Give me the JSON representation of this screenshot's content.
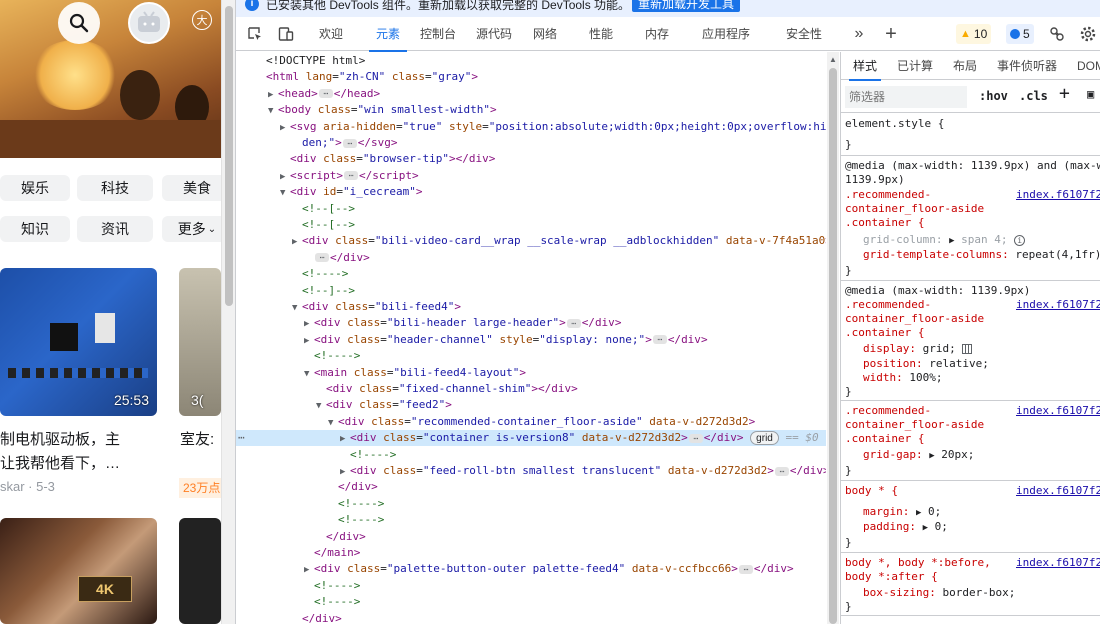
{
  "page": {
    "categories": [
      "娱乐",
      "科技",
      "美食",
      "知识",
      "资讯",
      "更多"
    ],
    "video1": {
      "duration": "25:53",
      "title_line1": "制电机驱动板，主",
      "title_line2": "让我帮他看下，…",
      "meta": "skar · 5-3"
    },
    "video2": {
      "duration": "3(",
      "title": "室友:",
      "hot": "23万点"
    },
    "video3": {
      "logo": "4K"
    }
  },
  "devtools": {
    "infobar": {
      "message": "已安装其他 DevTools 组件。重新加载以获取完整的 DevTools 功能。",
      "button": "重新加载开发工具"
    },
    "tabs": [
      "欢迎",
      "元素",
      "控制台",
      "源代码",
      "网络",
      "性能",
      "内存",
      "应用程序",
      "安全性"
    ],
    "active_tab": "元素",
    "warnings": "10",
    "messages": "5",
    "tree": [
      {
        "indent": 0,
        "tri": "",
        "html": "doctype"
      },
      {
        "indent": 0,
        "tri": "",
        "html": "html"
      },
      {
        "indent": 1,
        "tri": "▶",
        "html": "head"
      },
      {
        "indent": 1,
        "tri": "▼",
        "html": "body"
      },
      {
        "indent": 2,
        "tri": "▶",
        "html": "svg1"
      },
      {
        "indent": 2,
        "tri": "",
        "html": "svg2"
      },
      {
        "indent": 2,
        "tri": "",
        "html": "browsertip"
      },
      {
        "indent": 2,
        "tri": "▶",
        "html": "script"
      },
      {
        "indent": 2,
        "tri": "▼",
        "html": "icecream"
      },
      {
        "indent": 3,
        "tri": "",
        "html": "c1"
      },
      {
        "indent": 3,
        "tri": "",
        "html": "c2"
      },
      {
        "indent": 3,
        "tri": "▶",
        "html": "videocard"
      },
      {
        "indent": 3,
        "tri": "",
        "html": "videocard2"
      },
      {
        "indent": 3,
        "tri": "",
        "html": "c3"
      },
      {
        "indent": 3,
        "tri": "",
        "html": "c4"
      },
      {
        "indent": 3,
        "tri": "▼",
        "html": "feed4"
      },
      {
        "indent": 4,
        "tri": "▶",
        "html": "header"
      },
      {
        "indent": 4,
        "tri": "▶",
        "html": "channel"
      },
      {
        "indent": 4,
        "tri": "",
        "html": "c5"
      },
      {
        "indent": 4,
        "tri": "▼",
        "html": "main"
      },
      {
        "indent": 5,
        "tri": "",
        "html": "shim"
      },
      {
        "indent": 5,
        "tri": "▼",
        "html": "feed2"
      },
      {
        "indent": 6,
        "tri": "▼",
        "html": "floor"
      },
      {
        "indent": 7,
        "tri": "▶",
        "html": "container"
      },
      {
        "indent": 7,
        "tri": "",
        "html": "c6"
      },
      {
        "indent": 7,
        "tri": "▶",
        "html": "rollbtn"
      },
      {
        "indent": 6,
        "tri": "",
        "html": "cdiv1"
      },
      {
        "indent": 6,
        "tri": "",
        "html": "c7"
      },
      {
        "indent": 6,
        "tri": "",
        "html": "c8"
      },
      {
        "indent": 5,
        "tri": "",
        "html": "cdiv2"
      },
      {
        "indent": 4,
        "tri": "",
        "html": "cmain"
      },
      {
        "indent": 4,
        "tri": "▶",
        "html": "palette"
      },
      {
        "indent": 4,
        "tri": "",
        "html": "c9"
      },
      {
        "indent": 4,
        "tri": "",
        "html": "c10"
      },
      {
        "indent": 3,
        "tri": "",
        "html": "cdiv3"
      }
    ],
    "tree_text": {
      "doctype": "<!DOCTYPE html>",
      "html_tag": "html",
      "lang_attr": "lang",
      "lang_val": "\"zh-CN\"",
      "class_attr": "class",
      "gray_val": "\"gray\"",
      "head": "head",
      "body": "body",
      "body_class": "\"win smallest-width\"",
      "svg": "svg",
      "aria": "aria-hidden",
      "aria_val": "\"true\"",
      "style_attr": "style",
      "svg_style1": "\"position:absolute;width:0px;height:0px;overflow:hid",
      "svg_style2": "den;\"",
      "div": "div",
      "browser_tip": "\"browser-tip\"",
      "script": "script",
      "id_attr": "id",
      "icecream": "\"i_cecream\"",
      "c_open": "<!--[-->",
      "c_close": "<!--]-->",
      "c_dash": "<!---->",
      "video_card": "\"bili-video-card__wrap __scale-wrap __adblockhidden\"",
      "data_v1": "data-v-7f4a51a0",
      "feed4": "\"bili-feed4\"",
      "bili_header": "\"bili-header large-header\"",
      "header_channel": "\"header-channel\"",
      "display_none": "\"display: none;\"",
      "main": "main",
      "feed4_layout": "\"bili-feed4-layout\"",
      "fixed_shim": "\"fixed-channel-shim\"",
      "feed2": "\"feed2\"",
      "floor_aside": "\"recommended-container_floor-aside\"",
      "data_v2": "data-v-d272d3d2",
      "container_cls": "\"container is-version8\"",
      "grid": "grid",
      "eq0": "== $0",
      "roll_btn": "\"feed-roll-btn smallest translucent\"",
      "palette": "\"palette-button-outer palette-feed4\"",
      "data_v3": "data-v-ccfbcc66"
    },
    "styles": {
      "tabs": [
        "样式",
        "已计算",
        "布局",
        "事件侦听器",
        "DOM"
      ],
      "filter_placeholder": "筛选器",
      "hov": ":hov",
      "cls": ".cls",
      "element_style": "element.style {",
      "close_brace": "}",
      "media1": "@media (max-width: 1139.9px) and (max-w",
      "media1b": "1139.9px)",
      "media2": "@media (max-width: 1139.9px)",
      "sel_a": ".recommended-",
      "sel_b": "container_floor-aside",
      "sel_c": ".container {",
      "link": "index.f6107f2",
      "grid_column": "grid-column:",
      "grid_column_val": "span 4;",
      "gtc": "grid-template-columns:",
      "gtc_val": "repeat(4,1fr)",
      "display": "display:",
      "display_val": "grid;",
      "position": "position:",
      "position_val": "relative;",
      "width": "width:",
      "width_val": "100%;",
      "grid_gap": "grid-gap:",
      "grid_gap_val": "20px;",
      "body_star": "body * {",
      "margin": "margin:",
      "padding": "padding:",
      "zero": "0;",
      "body_before1": "body *, body *:before,",
      "body_before2": "body *:after {",
      "box_sizing": "box-sizing:",
      "box_sizing_val": "border-box;"
    }
  }
}
